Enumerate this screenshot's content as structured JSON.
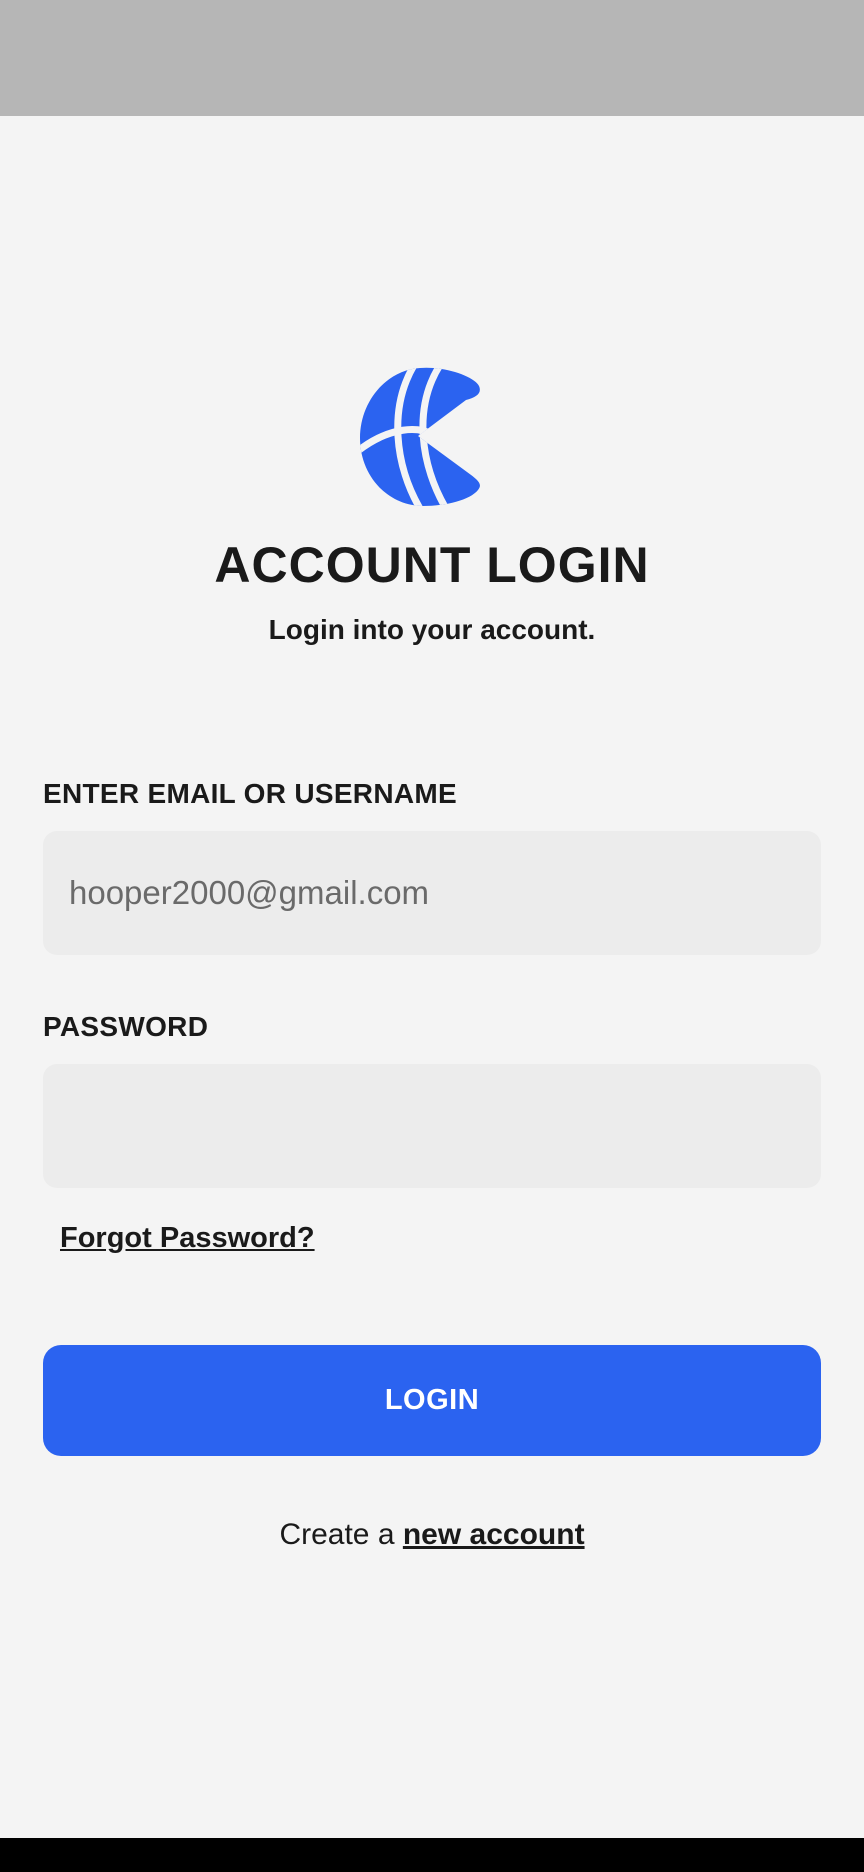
{
  "app": {
    "icon": "basketball-icon",
    "accent_color": "#2b63f0"
  },
  "header": {
    "title": "ACCOUNT LOGIN",
    "subtitle": "Login into your account."
  },
  "form": {
    "email": {
      "label": "ENTER EMAIL OR USERNAME",
      "placeholder": "hooper2000@gmail.com",
      "value": ""
    },
    "password": {
      "label": "PASSWORD",
      "placeholder": "",
      "value": ""
    },
    "forgot_label": "Forgot Password?",
    "login_label": "LOGIN"
  },
  "footer": {
    "create_prefix": "Create a",
    "create_link": "new account"
  }
}
